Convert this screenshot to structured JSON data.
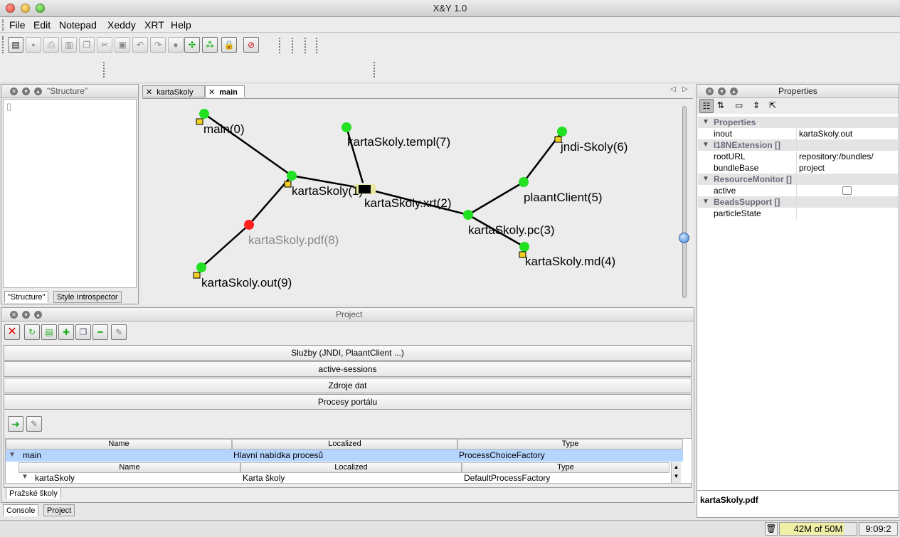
{
  "window": {
    "title": "X&Y 1.0"
  },
  "menu": [
    "File",
    "Edit",
    "Notepad",
    "Xeddy",
    "XRT",
    "Help"
  ],
  "toolbar_icons": [
    "new-icon",
    "save-icon",
    "print-icon",
    "print-preview-icon",
    "copy-icon",
    "cut-icon",
    "paste-icon",
    "undo-icon",
    "redo-icon",
    "help-icon",
    "layout-icon",
    "relayout-icon",
    "lock-icon",
    "no-pdf-icon"
  ],
  "structure": {
    "title": "\"Structure\"",
    "tabs": [
      "\"Structure\"",
      "Style Introspector"
    ]
  },
  "editor": {
    "tabs": [
      "kartaSkoly",
      "main"
    ],
    "nodes": [
      {
        "label": "main(0)",
        "color": "#22e022",
        "dim": false
      },
      {
        "label": "kartaSkoly.templ(7)",
        "color": "#22e022",
        "dim": false
      },
      {
        "label": "jndi-Skoly(6)",
        "color": "#22e022",
        "dim": false
      },
      {
        "label": "kartaSkoly(1)",
        "color": "#22e022",
        "dim": false
      },
      {
        "label": "kartaSkoly.xrt(2)",
        "color": "#22e022",
        "dim": false
      },
      {
        "label": "plaantClient(5)",
        "color": "#22e022",
        "dim": false
      },
      {
        "label": "kartaSkoly.pc(3)",
        "color": "#22e022",
        "dim": false
      },
      {
        "label": "kartaSkoly.pdf(8)",
        "color": "#ff2020",
        "dim": true
      },
      {
        "label": "kartaSkoly.md(4)",
        "color": "#22e022",
        "dim": false
      },
      {
        "label": "kartaSkoly.out(9)",
        "color": "#22e022",
        "dim": false
      }
    ]
  },
  "project": {
    "title": "Project",
    "groups": [
      "Služby (JNDI, PlaantClient ...)",
      "active-sessions",
      "Zdroje dat",
      "Procesy portálu"
    ],
    "table": {
      "columns": [
        "Name",
        "Localized",
        "Type"
      ],
      "row": {
        "name": "main",
        "localized": "Hlavní nabídka procesů",
        "type": "ProcessChoiceFactory"
      },
      "subcolumns": [
        "Name",
        "Localized",
        "Type"
      ],
      "subrow": {
        "name": "kartaSkoly",
        "localized": "Karta školy",
        "type": "DefaultProcessFactory"
      }
    },
    "bottom_tab": "Pražské školy"
  },
  "bottom_tabs": [
    "Console",
    "Project"
  ],
  "properties": {
    "title": "Properties",
    "groups": [
      {
        "name": "Properties",
        "rows": [
          {
            "key": "inout",
            "value": "kartaSkoly.out"
          }
        ]
      },
      {
        "name": "I18NExtension []",
        "rows": [
          {
            "key": "rootURL",
            "value": "repository:/bundles/"
          },
          {
            "key": "bundleBase",
            "value": "project"
          }
        ]
      },
      {
        "name": "ResourceMonitor []",
        "rows": [
          {
            "key": "active",
            "value": ""
          }
        ]
      },
      {
        "name": "BeadsSupport []",
        "rows": [
          {
            "key": "particleState",
            "value": ""
          }
        ]
      }
    ],
    "selected": "kartaSkoly.pdf"
  },
  "status": {
    "memory": "42M of 50M",
    "time": "9:09:2"
  }
}
